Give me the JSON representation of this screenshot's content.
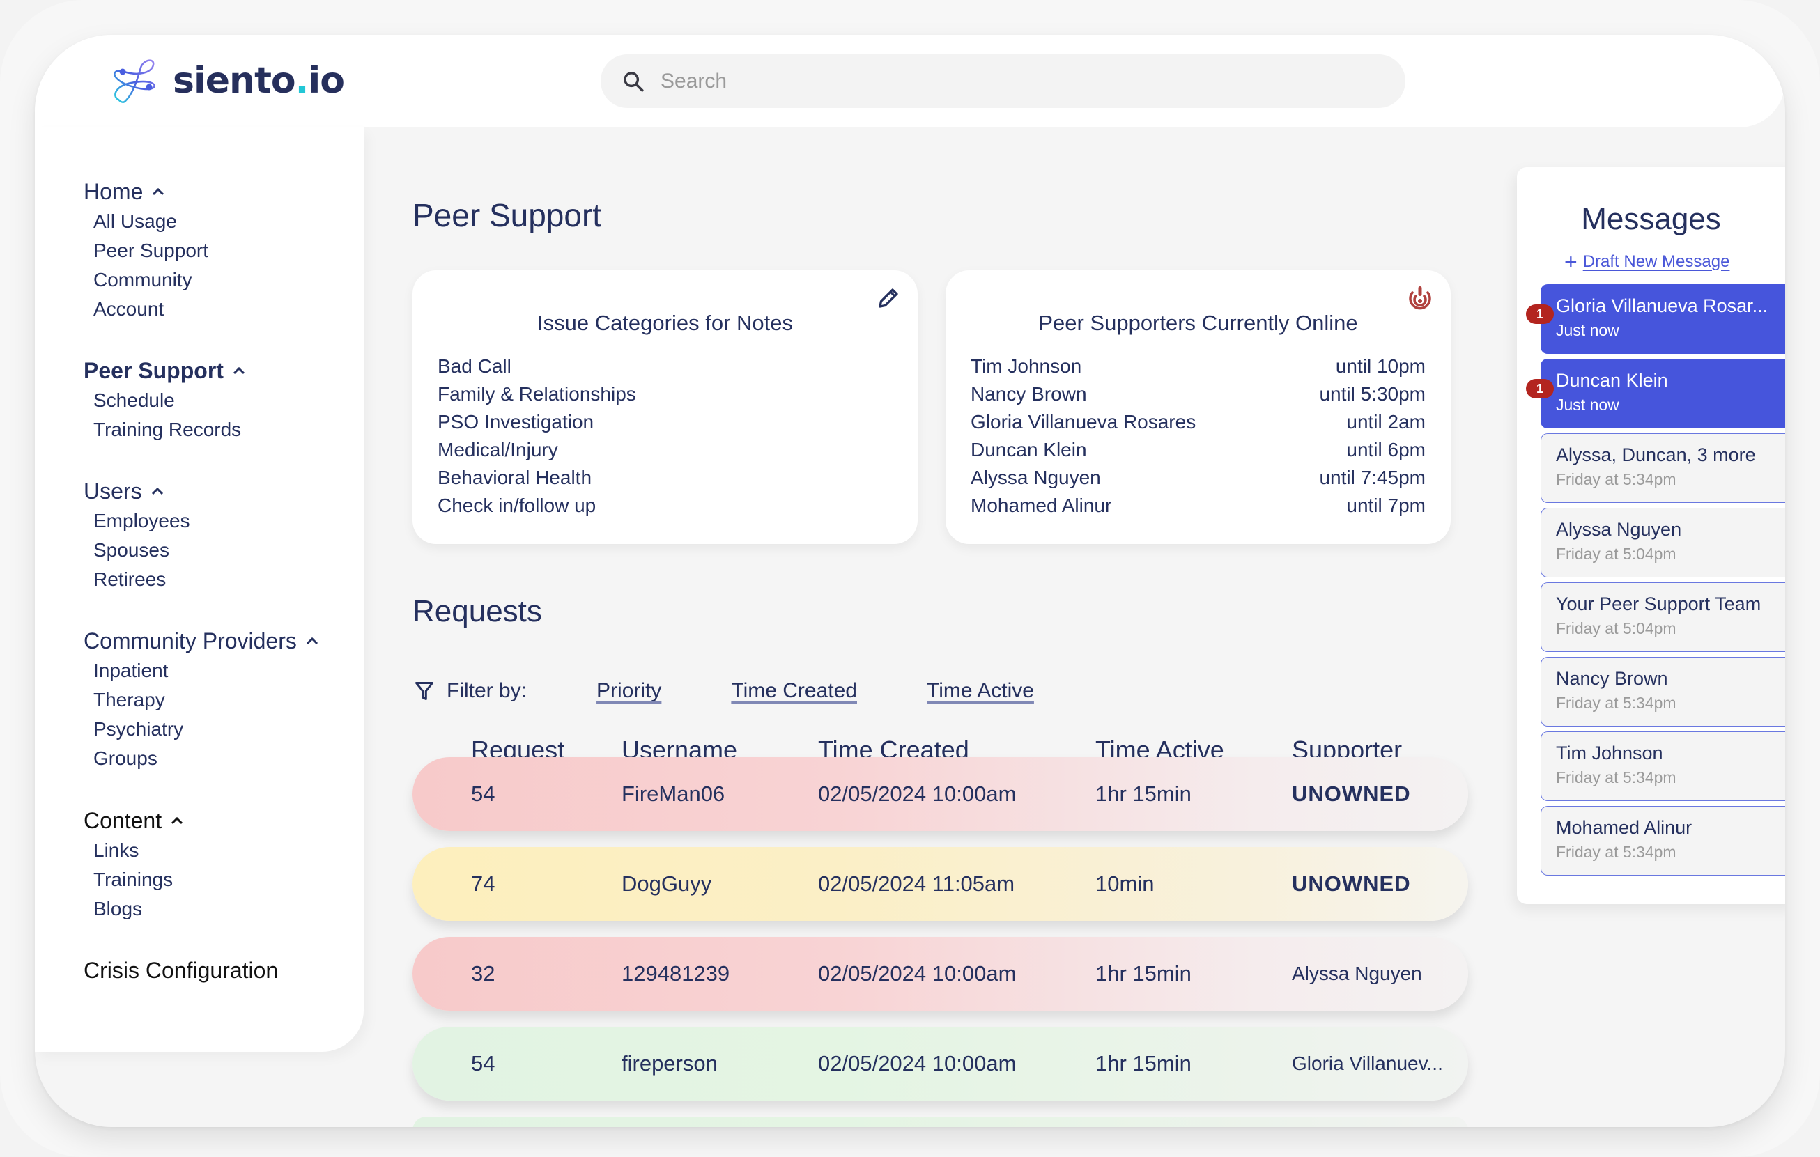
{
  "app": {
    "logo_text": "siento",
    "logo_dot": ".",
    "logo_suffix": "io"
  },
  "search": {
    "placeholder": "Search",
    "value": ""
  },
  "sidebar": {
    "groups": [
      {
        "label": "Home",
        "items": [
          "All Usage",
          "Peer Support",
          "Community",
          "Account"
        ]
      },
      {
        "label": "Peer Support",
        "items": [
          "Schedule",
          "Training Records"
        ],
        "active": true
      },
      {
        "label": "Users",
        "items": [
          "Employees",
          "Spouses",
          "Retirees"
        ]
      },
      {
        "label": "Community Providers",
        "items": [
          "Inpatient",
          "Therapy",
          "Psychiatry",
          "Groups"
        ]
      },
      {
        "label": "Content",
        "items": [
          "Links",
          "Trainings",
          "Blogs"
        ]
      }
    ],
    "crisis": "Crisis Configuration"
  },
  "page": {
    "title": "Peer Support"
  },
  "issue_card": {
    "title": "Issue Categories for Notes",
    "edit_icon": "pencil-icon",
    "items": [
      "Bad Call",
      "Family & Relationships",
      "PSO Investigation",
      "Medical/Injury",
      "Behavioral Health",
      "Check in/follow up"
    ]
  },
  "online_card": {
    "title": "Peer Supporters Currently Online",
    "alert_icon": "alert-broadcast-icon",
    "alert_color": "#b0413e",
    "supporters": [
      {
        "name": "Tim Johnson",
        "until": "until 10pm"
      },
      {
        "name": "Nancy Brown",
        "until": "until 5:30pm"
      },
      {
        "name": "Gloria Villanueva Rosares",
        "until": "until 2am"
      },
      {
        "name": "Duncan Klein",
        "until": "until 6pm"
      },
      {
        "name": "Alyssa Nguyen",
        "until": "until 7:45pm"
      },
      {
        "name": "Mohamed Alinur",
        "until": "until 7pm"
      }
    ]
  },
  "requests": {
    "title": "Requests",
    "filter_label": "Filter by:",
    "filters": [
      "Priority",
      "Time Created",
      "Time Active"
    ],
    "columns": [
      "Request",
      "Username",
      "Time Created",
      "Time Active",
      "Supporter"
    ],
    "rows": [
      {
        "request": "54",
        "username": "FireMan06",
        "time_created": "02/05/2024 10:00am",
        "time_active": "1hr 15min",
        "supporter": "UNOWNED",
        "priority": "high"
      },
      {
        "request": "74",
        "username": "DogGuyy",
        "time_created": "02/05/2024 11:05am",
        "time_active": "10min",
        "supporter": "UNOWNED",
        "priority": "medium"
      },
      {
        "request": "32",
        "username": "129481239",
        "time_created": "02/05/2024 10:00am",
        "time_active": "1hr 15min",
        "supporter": "Alyssa Nguyen",
        "priority": "high"
      },
      {
        "request": "54",
        "username": "fireperson",
        "time_created": "02/05/2024 10:00am",
        "time_active": "1hr 15min",
        "supporter": "Gloria Villanuev...",
        "priority": "low"
      }
    ],
    "priority_colors": {
      "high": "#f7caca",
      "medium": "#fdefbd",
      "low": "#e2f3e3"
    }
  },
  "messages": {
    "title": "Messages",
    "draft_label": "Draft New Message",
    "accent": "#4655dc",
    "badge_color": "#b3241f",
    "items": [
      {
        "name": "Gloria Villanueva Rosar...",
        "time": "Just now",
        "unread": true,
        "badge": "1"
      },
      {
        "name": "Duncan Klein",
        "time": "Just now",
        "unread": true,
        "badge": "1"
      },
      {
        "name": "Alyssa, Duncan, 3 more",
        "time": "Friday at 5:34pm",
        "unread": false
      },
      {
        "name": "Alyssa Nguyen",
        "time": "Friday at 5:04pm",
        "unread": false
      },
      {
        "name": "Your Peer Support Team",
        "time": "Friday at 5:04pm",
        "unread": false
      },
      {
        "name": "Nancy Brown",
        "time": "Friday at 5:34pm",
        "unread": false
      },
      {
        "name": "Tim Johnson",
        "time": "Friday at 5:34pm",
        "unread": false
      },
      {
        "name": "Mohamed Alinur",
        "time": "Friday at 5:34pm",
        "unread": false
      }
    ]
  }
}
